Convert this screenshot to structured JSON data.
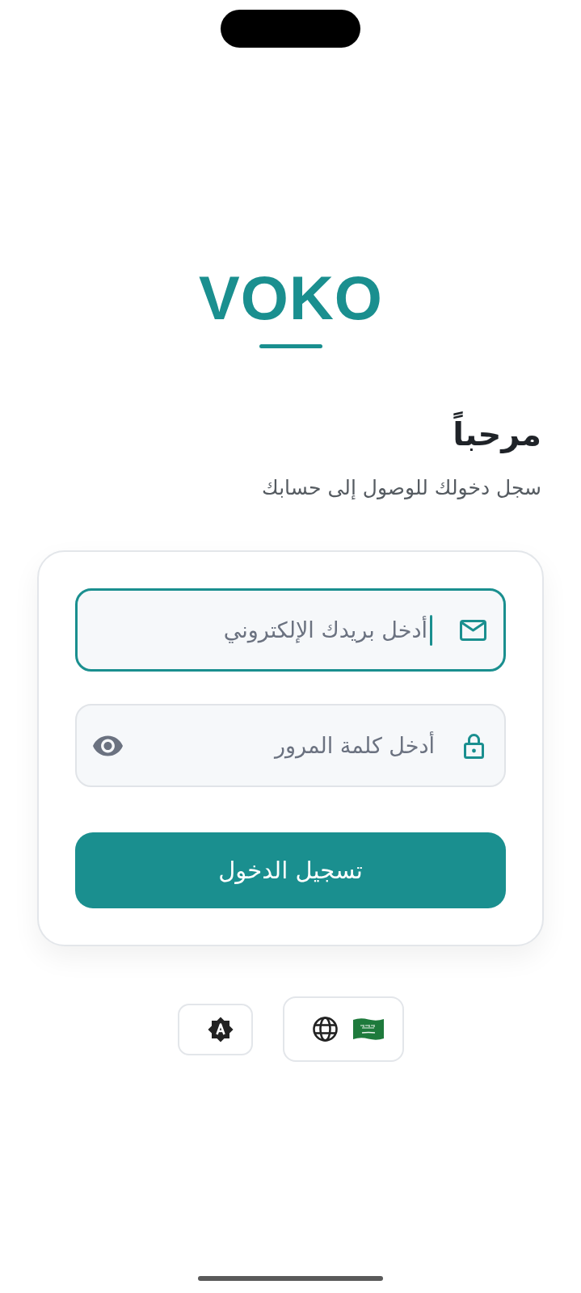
{
  "logo": {
    "text": "VOKO"
  },
  "intro": {
    "title": "مرحباً",
    "subtitle": "سجل دخولك للوصول إلى حسابك"
  },
  "form": {
    "fields": [
      {
        "kind": "email",
        "placeholder": "أدخل بريدك الإلكتروني",
        "focused": true
      },
      {
        "kind": "password",
        "placeholder": "أدخل كلمة المرور",
        "focused": false
      }
    ],
    "submit": {
      "label": "تسجيل الدخول"
    }
  },
  "settings_buttons": [
    {
      "kind": "language"
    },
    {
      "kind": "theme"
    }
  ]
}
